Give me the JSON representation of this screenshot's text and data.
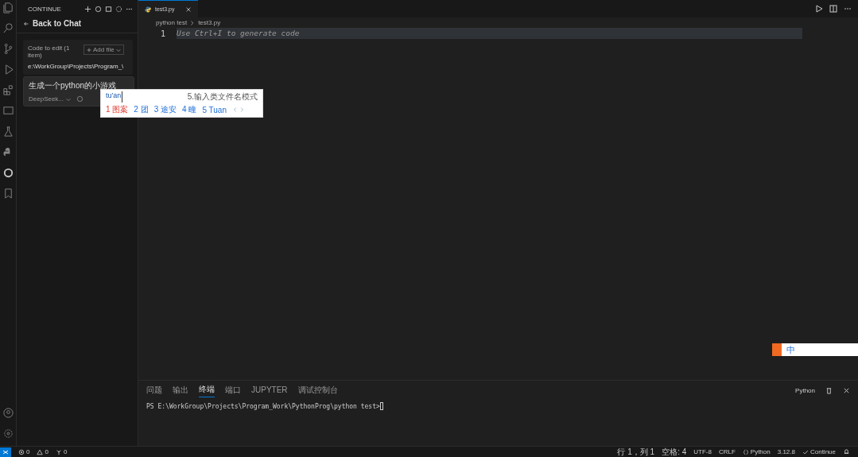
{
  "sidebar": {
    "title": "CONTINUE",
    "back_label": "Back to Chat",
    "context": {
      "label": "Code to edit (1 item)",
      "add_button": "Add file",
      "path": "e:\\WorkGroup\\Projects\\Program_\\"
    },
    "input": {
      "value": "生成一个python的小游戏",
      "model": "DeepSeek..."
    }
  },
  "ime": {
    "composition": "tu'an",
    "hint": "5.输入类文件名模式",
    "candidates": [
      {
        "index": "1",
        "text": "图案",
        "selected": true
      },
      {
        "index": "2",
        "text": "团",
        "selected": false
      },
      {
        "index": "3",
        "text": "途安",
        "selected": false
      },
      {
        "index": "4",
        "text": "疃",
        "selected": false
      },
      {
        "index": "5",
        "text": "Tuan",
        "selected": false
      }
    ],
    "toolbar_label": "中"
  },
  "editor": {
    "tab": "test3.py",
    "breadcrumb": [
      "python test",
      "test3.py"
    ],
    "line_number": "1",
    "placeholder": "Use Ctrl+I to generate code"
  },
  "panel": {
    "tabs": [
      {
        "label": "问题",
        "selected": false
      },
      {
        "label": "输出",
        "selected": false
      },
      {
        "label": "终端",
        "selected": true
      },
      {
        "label": "端口",
        "selected": false
      },
      {
        "label": "JUPYTER",
        "selected": false
      },
      {
        "label": "调试控制台",
        "selected": false
      }
    ],
    "shell": "Python",
    "prompt": "PS E:\\WorkGroup\\Projects\\Program_Work\\PythonProg\\python test> "
  },
  "status_bar": {
    "errors": "0",
    "warnings": "0",
    "ports": "0",
    "position": "行 1，列 1",
    "indent": "空格: 4",
    "encoding": "UTF-8",
    "eol": "CRLF",
    "language": "Python",
    "version": "3.12.8",
    "extension": "Continue"
  }
}
